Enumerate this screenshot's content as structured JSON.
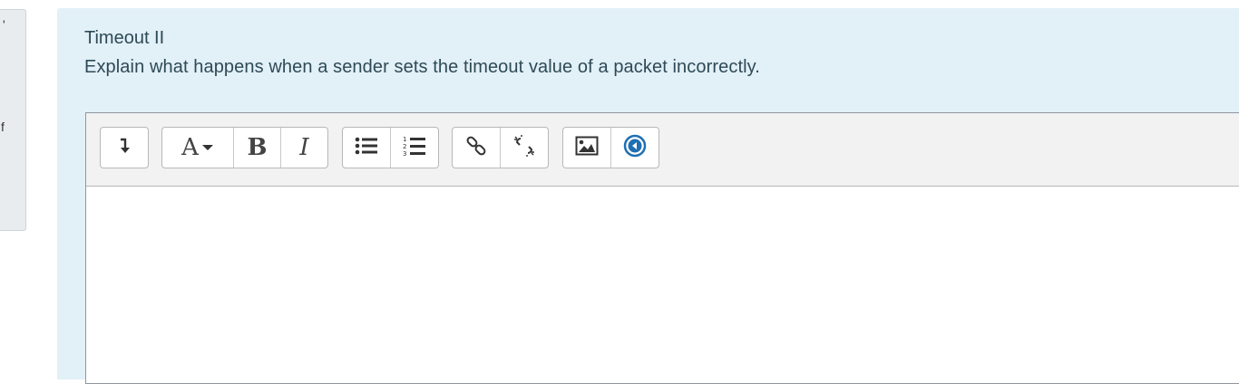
{
  "side": {
    "fragment_top": "'",
    "fragment_mid": "f"
  },
  "question": {
    "title": "Timeout II",
    "text": "Explain what happens when a sender sets the timeout value of a packet incorrectly."
  },
  "toolbar": {
    "groups": [
      {
        "buttons": [
          {
            "icon": "collapse-icon"
          }
        ]
      },
      {
        "buttons": [
          {
            "icon": "text-style-icon",
            "label": "A"
          },
          {
            "icon": "bold-icon",
            "label": "B"
          },
          {
            "icon": "italic-icon",
            "label": "I"
          }
        ]
      },
      {
        "buttons": [
          {
            "icon": "unordered-list-icon"
          },
          {
            "icon": "ordered-list-icon"
          }
        ]
      },
      {
        "buttons": [
          {
            "icon": "link-icon"
          },
          {
            "icon": "unlink-icon"
          }
        ]
      },
      {
        "buttons": [
          {
            "icon": "image-icon"
          },
          {
            "icon": "media-icon"
          }
        ]
      }
    ]
  },
  "editor": {
    "content": ""
  },
  "colors": {
    "panel_bg": "#e2f0f7",
    "text": "#2e4a56",
    "media_blue": "#1f6fb2"
  }
}
